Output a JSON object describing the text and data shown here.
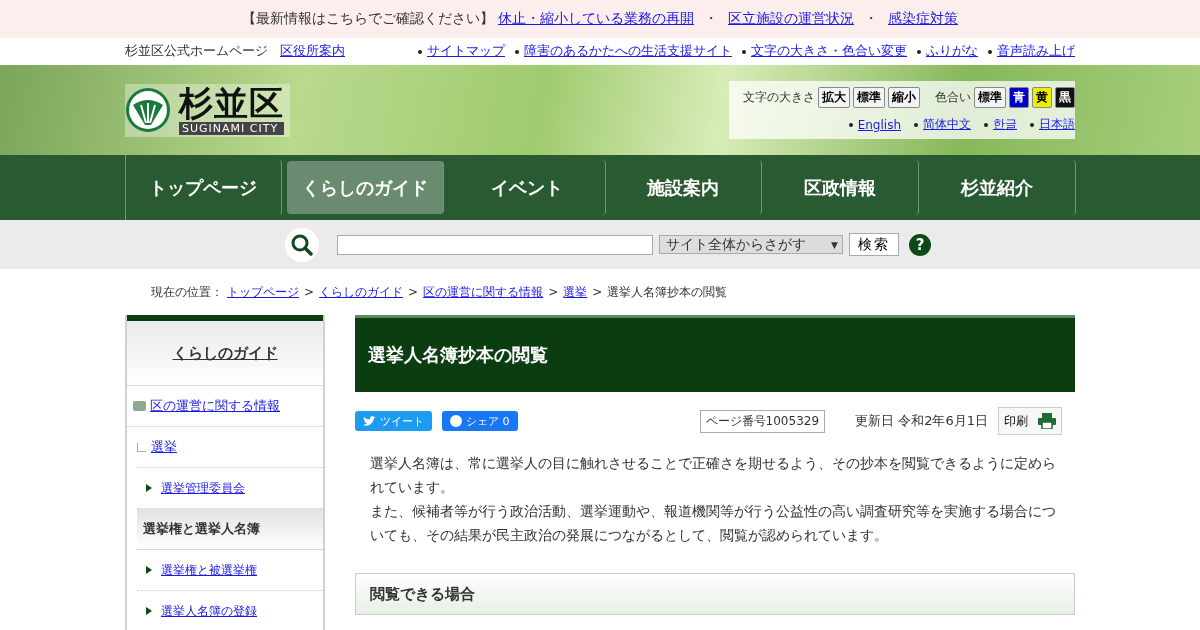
{
  "notice": {
    "lead": "【最新情報はこちらでご確認ください】",
    "links": [
      "休止・縮小している業務の再開",
      "区立施設の運営状況",
      "感染症対策"
    ],
    "separator": "・"
  },
  "utility": {
    "site_name": "杉並区公式ホームページ",
    "office_link": "区役所案内",
    "links": [
      "サイトマップ",
      "障害のあるかたへの生活支援サイト",
      "文字の大きさ・色合い変更",
      "ふりがな",
      "音声読み上げ"
    ]
  },
  "header": {
    "logo_kanji": "杉並区",
    "logo_roman": "SUGINAMI CITY",
    "font_size_label": "文字の大きさ",
    "font_size_buttons": [
      "拡大",
      "標準",
      "縮小"
    ],
    "color_label": "色合い",
    "color_buttons": [
      {
        "label": "標準",
        "color": "#f4f4f4"
      },
      {
        "label": "青",
        "color": "#0000cc"
      },
      {
        "label": "黄",
        "color": "#eeee00"
      },
      {
        "label": "黒",
        "color": "#111111"
      }
    ],
    "languages": [
      "English",
      "简体中文",
      "한글",
      "日本語"
    ]
  },
  "nav": [
    {
      "label": "トップページ",
      "selected": false
    },
    {
      "label": "くらしのガイド",
      "selected": true
    },
    {
      "label": "イベント",
      "selected": false
    },
    {
      "label": "施設案内",
      "selected": false
    },
    {
      "label": "区政情報",
      "selected": false
    },
    {
      "label": "杉並紹介",
      "selected": false
    }
  ],
  "search": {
    "scope": "サイト全体からさがす",
    "caret": "▼",
    "button": "検索",
    "help": "?"
  },
  "breadcrumb": {
    "label": "現在の位置：",
    "separator": ">",
    "links": [
      "トップページ",
      "くらしのガイド",
      "区の運営に関する情報",
      "選挙"
    ],
    "current": "選挙人名簿抄本の閲覧"
  },
  "sidebar": {
    "title": "くらしのガイド",
    "items": [
      {
        "kind": "folder",
        "label": "区の運営に関する情報"
      },
      {
        "kind": "sub",
        "label": "選挙"
      },
      {
        "kind": "arrow",
        "label": "選挙管理委員会"
      },
      {
        "kind": "current",
        "label": "選挙権と選挙人名簿"
      },
      {
        "kind": "arrow",
        "label": "選挙権と被選挙権"
      },
      {
        "kind": "arrow",
        "label": "選挙人名簿の登録"
      }
    ]
  },
  "article": {
    "title": "選挙人名簿抄本の閲覧",
    "tweet": "ツイート",
    "share": "シェア 0",
    "page_number": "ページ番号1005329",
    "updated": "更新日 令和2年6月1日",
    "print": "印刷",
    "paragraphs": [
      "選挙人名簿は、常に選挙人の目に触れさせることで正確さを期せるよう、その抄本を閲覧できるように定められています。",
      "また、候補者等が行う政治活動、選挙運動や、報道機関等が行う公益性の高い調査研究等を実施する場合についても、その結果が民主政治の発展につながるとして、閲覧が認められています。"
    ],
    "section_heading": "閲覧できる場合"
  }
}
